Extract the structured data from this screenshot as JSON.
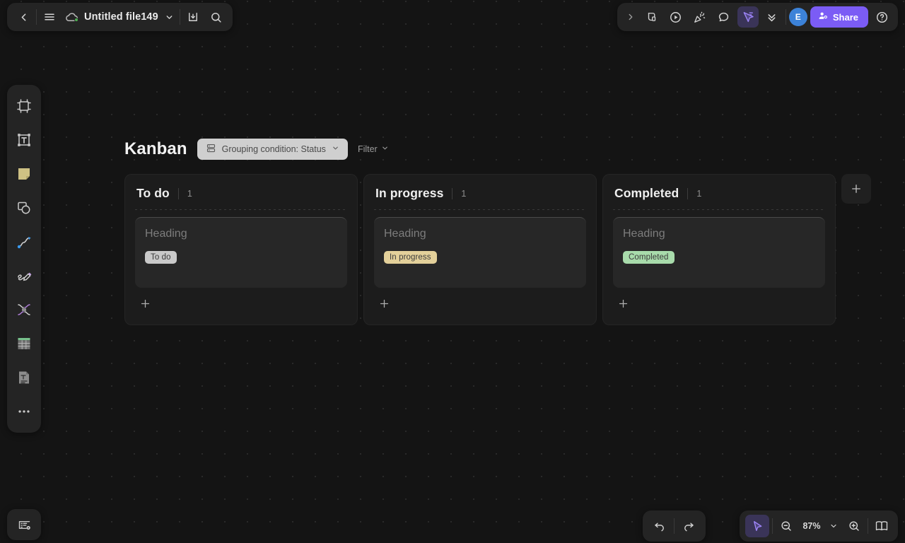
{
  "app": {
    "file_title": "Untitled file149",
    "zoom_level": "87%"
  },
  "top_left_toolbar": {
    "back_label": "Back",
    "menu_label": "Menu",
    "cloud_status_label": "Synced",
    "dropdown_label": "File options",
    "download_label": "Download",
    "search_label": "Search"
  },
  "top_right_toolbar": {
    "expand_label": "Expand",
    "ai_label": "AI assistant",
    "present_label": "Present",
    "celebrate_label": "Celebrate",
    "comment_label": "Comment",
    "cursor_label": "Cursor chat",
    "more_label": "More",
    "avatar_initial": "E",
    "share_label": "Share",
    "help_label": "Help"
  },
  "left_rail": {
    "items": [
      {
        "icon": "frame-icon",
        "label": "Frame"
      },
      {
        "icon": "text-icon",
        "label": "Text"
      },
      {
        "icon": "sticky-note-icon",
        "label": "Sticky note"
      },
      {
        "icon": "shapes-icon",
        "label": "Shapes"
      },
      {
        "icon": "connector-icon",
        "label": "Connector"
      },
      {
        "icon": "pen-icon",
        "label": "Pen"
      },
      {
        "icon": "mindmap-icon",
        "label": "Mind map"
      },
      {
        "icon": "table-icon",
        "label": "Table"
      },
      {
        "icon": "document-icon",
        "label": "Document"
      },
      {
        "icon": "more-icon",
        "label": "More tools"
      }
    ]
  },
  "bottom_left": {
    "presentation_label": "Presentation mode"
  },
  "bottom_right": {
    "undo_label": "Undo",
    "redo_label": "Redo",
    "select_label": "Select",
    "zoom_out_label": "Zoom out",
    "zoom_in_label": "Zoom in",
    "zoom_dropdown_label": "Zoom options",
    "minimap_label": "Minimap"
  },
  "kanban": {
    "title": "Kanban",
    "grouping_label": "Grouping condition: Status",
    "filter_label": "Filter",
    "add_column_label": "+",
    "add_card_label": "+",
    "columns": [
      {
        "name": "To do",
        "count": "1",
        "cards": [
          {
            "heading": "Heading",
            "badge": "To do",
            "badge_bg": "#c9c9c9"
          }
        ]
      },
      {
        "name": "In progress",
        "count": "1",
        "cards": [
          {
            "heading": "Heading",
            "badge": "In progress",
            "badge_bg": "#e3d09a"
          }
        ]
      },
      {
        "name": "Completed",
        "count": "1",
        "cards": [
          {
            "heading": "Heading",
            "badge": "Completed",
            "badge_bg": "#a8dbab"
          }
        ]
      }
    ]
  },
  "colors": {
    "accent_purple": "#7b5cf5",
    "avatar_blue": "#3c82d8",
    "canvas_bg": "#141414",
    "panel_bg": "#242424",
    "column_bg": "#1c1c1c",
    "card_bg": "#272727"
  }
}
